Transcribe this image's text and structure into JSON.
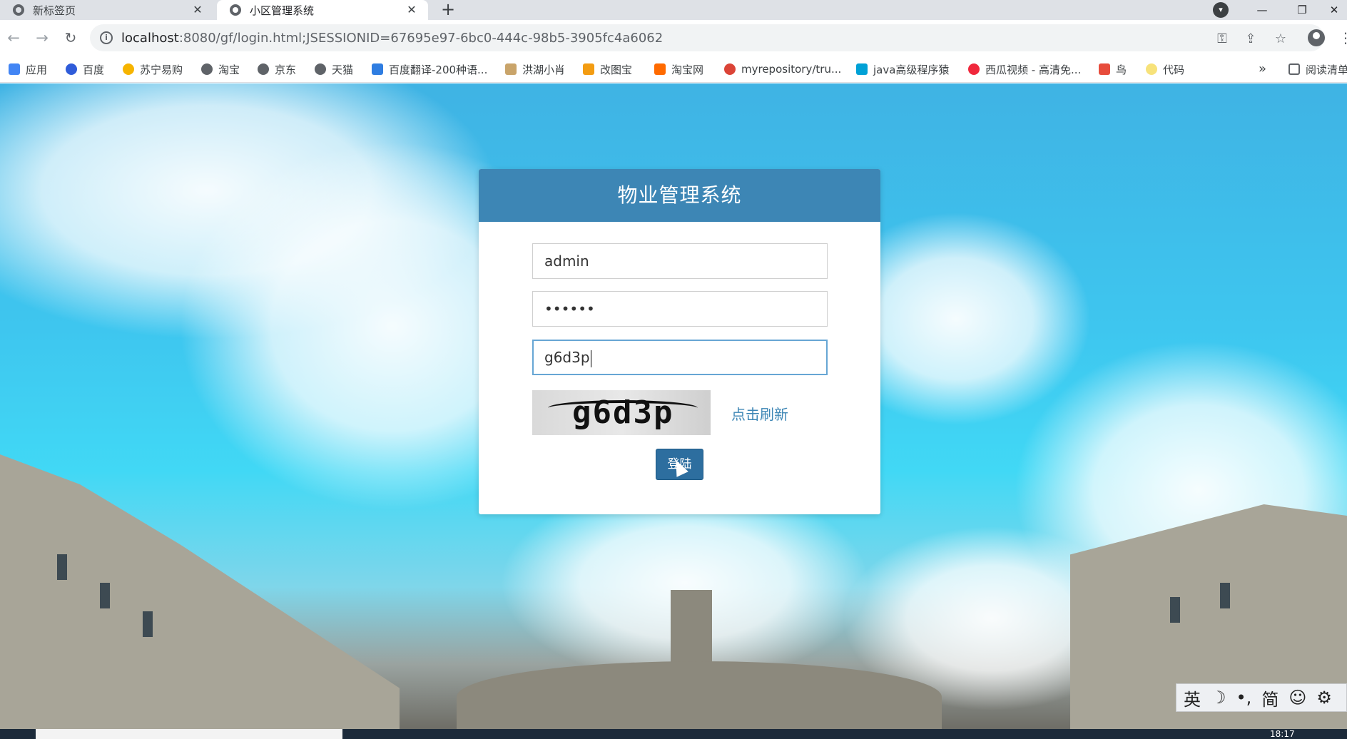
{
  "browser": {
    "tabs": [
      {
        "title": "新标签页",
        "active": false
      },
      {
        "title": "小区管理系统",
        "active": true
      }
    ],
    "new_tab_label": "+",
    "url": {
      "host": "localhost",
      "rest": ":8080/gf/login.html;JSESSIONID=67695e97-6bc0-444c-98b5-3905fc4a6062"
    },
    "bookmarks": [
      {
        "label": "应用",
        "icon": "apps-grid-icon"
      },
      {
        "label": "百度",
        "icon": "baidu-paw-icon"
      },
      {
        "label": "苏宁易购",
        "icon": "suning-icon"
      },
      {
        "label": "淘宝",
        "icon": "globe-icon"
      },
      {
        "label": "京东",
        "icon": "globe-icon"
      },
      {
        "label": "天猫",
        "icon": "globe-icon"
      },
      {
        "label": "百度翻译-200种语...",
        "icon": "translate-icon"
      },
      {
        "label": "洪湖小肖",
        "icon": "bird-icon"
      },
      {
        "label": "改图宝",
        "icon": "folder-icon"
      },
      {
        "label": "淘宝网",
        "icon": "taobao-icon"
      },
      {
        "label": "myrepository/tru...",
        "icon": "chrome-icon"
      },
      {
        "label": "java高级程序猿",
        "icon": "bilibili-icon"
      },
      {
        "label": "西瓜视频 - 高清免...",
        "icon": "xigua-icon"
      },
      {
        "label": "鸟",
        "icon": "bird-icon"
      },
      {
        "label": "代码",
        "icon": "bulb-icon"
      }
    ],
    "bookmarks_more": "»",
    "reading_list": "阅读清单"
  },
  "login": {
    "title": "物业管理系统",
    "username": "admin",
    "password_mask": "••••••",
    "captcha_input": "g6d3p",
    "captcha_image_text": "g6d3p",
    "refresh_label": "点击刷新",
    "submit_label": "登陆"
  },
  "ime": {
    "lang": "英",
    "moon": "☽",
    "punct": "•,",
    "script": "简",
    "emoji": "☺",
    "settings": "⚙"
  },
  "taskbar": {
    "time": "18:17"
  },
  "colors": {
    "header": "#3d86b5",
    "button": "#2d6e9f",
    "link": "#3d86b5"
  }
}
